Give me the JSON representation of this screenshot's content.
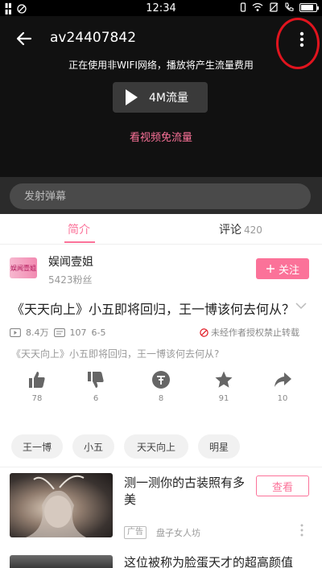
{
  "status_bar": {
    "time": "12:34",
    "battery_level": 0.85,
    "left_icons": [
      "signal-icon",
      "block-icon"
    ],
    "right_icons": [
      "vibrate-icon",
      "wifi-icon",
      "no-sim-icon",
      "call-icon",
      "battery-icon"
    ]
  },
  "player": {
    "title": "av24407842",
    "notice": "正在使用非WIFI网络，播放将产生流量费用",
    "play_label": "4M流量",
    "free_link": "看视频免流量",
    "more_icon": "more-vertical-icon",
    "back_icon": "back-arrow-icon"
  },
  "danmaku": {
    "placeholder": "发射弹幕"
  },
  "tabs": {
    "intro": "简介",
    "comments": "评论",
    "comments_count": "420"
  },
  "uploader": {
    "avatar_text": "娱闻壹姐",
    "name": "娱闻壹姐",
    "fans": "5423粉丝",
    "follow_label": "关注",
    "follow_icon": "plus-icon"
  },
  "video": {
    "title": "《天天向上》小五即将回归，王一博该何去何从？",
    "views": "8.4万",
    "danmaku_count": "107",
    "date": "6-5",
    "no_reprint": "未经作者授权禁止转载",
    "description": "《天天向上》小五即将回归，王一博该何去何从?"
  },
  "actions": [
    {
      "icon": "thumbs-up-icon",
      "count": "78"
    },
    {
      "icon": "thumbs-down-icon",
      "count": "6"
    },
    {
      "icon": "coin-icon",
      "count": "8"
    },
    {
      "icon": "star-icon",
      "count": "91"
    },
    {
      "icon": "share-icon",
      "count": "10"
    }
  ],
  "tags": [
    "王一博",
    "小五",
    "天天向上",
    "明星"
  ],
  "related": [
    {
      "title": "测一测你的古装照有多美",
      "button": "查看",
      "badge": "广告",
      "source": "盘子女人坊"
    },
    {
      "title": "这位被称为脸蛋天才的超高颜值"
    }
  ],
  "colors": {
    "accent": "#fb7299",
    "player_bg": "#111111",
    "annotation_red": "#e0141e"
  }
}
